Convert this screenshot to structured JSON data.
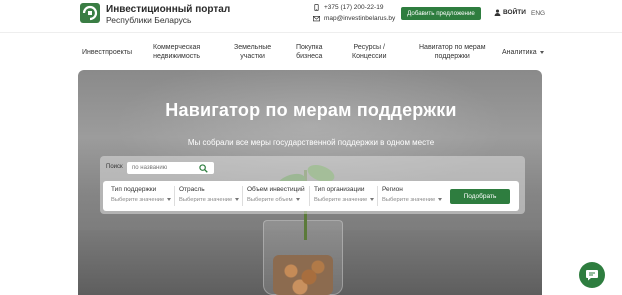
{
  "header": {
    "title": "Инвестиционный портал",
    "subtitle": "Республики Беларусь",
    "phone": "+375 (17) 200-22-19",
    "email": "map@investinbelarus.by",
    "add_button": "Добавить предложение",
    "login": "ВОЙТИ",
    "lang": "ENG",
    "brand_color": "#2e7d3f"
  },
  "nav": {
    "items": [
      {
        "label": "Инвестпроекты"
      },
      {
        "label1": "Коммерческая",
        "label2": "недвижимость"
      },
      {
        "label1": "Земельные",
        "label2": "участки"
      },
      {
        "label1": "Покупка",
        "label2": "бизнеса"
      },
      {
        "label1": "Ресурсы /",
        "label2": "Концессии"
      },
      {
        "label1": "Навигатор по мерам",
        "label2": "поддержки"
      },
      {
        "label": "Аналитика"
      }
    ]
  },
  "hero": {
    "title": "Навигатор по мерам поддержки",
    "subtitle": "Мы собрали все меры государственной поддержки в одном месте"
  },
  "search": {
    "label": "Поиск",
    "placeholder": "по названию"
  },
  "filters": [
    {
      "label": "Тип поддержки",
      "value": "Выберите значение"
    },
    {
      "label": "Отрасль",
      "value": "Выберите значение"
    },
    {
      "label": "Объем инвестиций",
      "value": "Выберите объем"
    },
    {
      "label": "Тип организации",
      "value": "Выберите значение"
    },
    {
      "label": "Регион",
      "value": "Выберите значение"
    }
  ],
  "submit_button": "Подобрать",
  "icons": [
    "logo-icon",
    "phone-icon",
    "mail-icon",
    "user-icon",
    "search-icon",
    "chat-icon"
  ]
}
